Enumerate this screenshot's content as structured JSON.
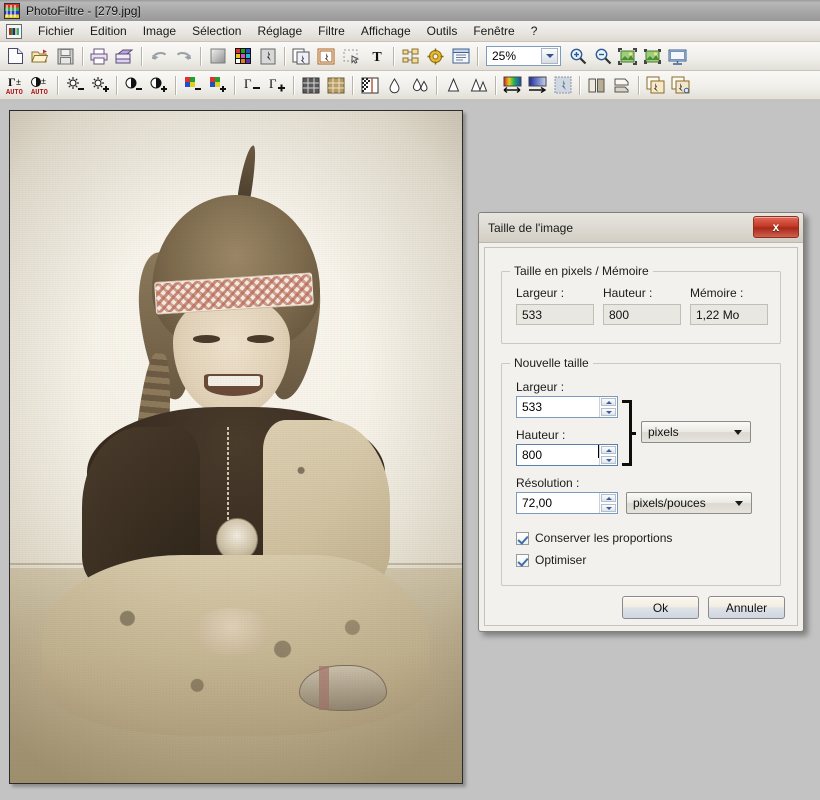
{
  "window": {
    "title": "PhotoFiltre - [279.jpg]",
    "app_icon": "photofiltre-icon"
  },
  "menubar": {
    "doc_icon": "document-icon",
    "items": [
      {
        "label": "Fichier"
      },
      {
        "label": "Edition"
      },
      {
        "label": "Image"
      },
      {
        "label": "Sélection"
      },
      {
        "label": "Réglage"
      },
      {
        "label": "Filtre"
      },
      {
        "label": "Affichage"
      },
      {
        "label": "Outils"
      },
      {
        "label": "Fenêtre"
      },
      {
        "label": "?"
      }
    ]
  },
  "toolbar_main": {
    "zoom_value": "25%",
    "buttons": [
      {
        "name": "new-document-icon"
      },
      {
        "name": "open-folder-icon"
      },
      {
        "name": "save-floppy-icon"
      },
      {
        "name": "separator"
      },
      {
        "name": "print-icon"
      },
      {
        "name": "print-preview-icon"
      },
      {
        "name": "separator"
      },
      {
        "name": "undo-icon"
      },
      {
        "name": "redo-icon"
      },
      {
        "name": "separator"
      },
      {
        "name": "grayscale-icon"
      },
      {
        "name": "color-palette-icon"
      },
      {
        "name": "negative-icon"
      },
      {
        "name": "separator"
      },
      {
        "name": "copy-image-icon"
      },
      {
        "name": "paste-image-icon"
      },
      {
        "name": "selection-icon"
      },
      {
        "name": "text-tool-icon"
      },
      {
        "name": "separator"
      },
      {
        "name": "explorer-icon"
      },
      {
        "name": "settings-gear-icon"
      },
      {
        "name": "palette-window-icon"
      },
      {
        "name": "separator"
      },
      {
        "name": "zoom-combo"
      },
      {
        "name": "zoom-in-icon"
      },
      {
        "name": "zoom-out-icon"
      },
      {
        "name": "fit-screen-icon"
      },
      {
        "name": "actual-size-icon"
      },
      {
        "name": "fullscreen-icon"
      }
    ]
  },
  "toolbar_adjust": {
    "buttons": [
      {
        "name": "auto-gamma-icon"
      },
      {
        "name": "auto-contrast-icon"
      },
      {
        "name": "separator"
      },
      {
        "name": "brightness-down-icon"
      },
      {
        "name": "brightness-up-icon"
      },
      {
        "name": "separator"
      },
      {
        "name": "contrast-down-icon"
      },
      {
        "name": "contrast-up-icon"
      },
      {
        "name": "separator"
      },
      {
        "name": "saturation-down-icon"
      },
      {
        "name": "saturation-up-icon"
      },
      {
        "name": "separator"
      },
      {
        "name": "gamma-down-icon"
      },
      {
        "name": "gamma-up-icon"
      },
      {
        "name": "separator"
      },
      {
        "name": "grid-dark-icon"
      },
      {
        "name": "grid-sepia-icon"
      },
      {
        "name": "separator"
      },
      {
        "name": "dither-icon"
      },
      {
        "name": "blur-icon"
      },
      {
        "name": "blur-more-icon"
      },
      {
        "name": "separator"
      },
      {
        "name": "sharpen-icon"
      },
      {
        "name": "sharpen-more-icon"
      },
      {
        "name": "separator"
      },
      {
        "name": "gradient-icon"
      },
      {
        "name": "gradient-blue-icon"
      },
      {
        "name": "emboss-icon"
      },
      {
        "name": "separator"
      },
      {
        "name": "flip-horizontal-icon"
      },
      {
        "name": "flip-vertical-icon"
      },
      {
        "name": "separator"
      },
      {
        "name": "duplicate-icon"
      },
      {
        "name": "batch-icon"
      }
    ]
  },
  "canvas": {
    "image_name": "279.jpg",
    "alt": "Sepia portrait photograph of a smiling young girl in a native american costume with feather headband, sitting cross-legged"
  },
  "dialog": {
    "title": "Taille de l'image",
    "close_label": "x",
    "group_pixels": {
      "legend": "Taille en pixels / Mémoire",
      "width_label": "Largeur :",
      "width_value": "533",
      "height_label": "Hauteur :",
      "height_value": "800",
      "memory_label": "Mémoire :",
      "memory_value": "1,22 Mo"
    },
    "group_new_size": {
      "legend": "Nouvelle taille",
      "width_label": "Largeur :",
      "width_value": "533",
      "height_label": "Hauteur :",
      "height_value": "800",
      "unit_value": "pixels",
      "resolution_label": "Résolution :",
      "resolution_value": "72,00",
      "resolution_unit_value": "pixels/pouces",
      "keep_ratio_label": "Conserver les proportions",
      "keep_ratio_checked": true,
      "optimize_label": "Optimiser",
      "optimize_checked": true
    },
    "ok_label": "Ok",
    "cancel_label": "Annuler"
  }
}
